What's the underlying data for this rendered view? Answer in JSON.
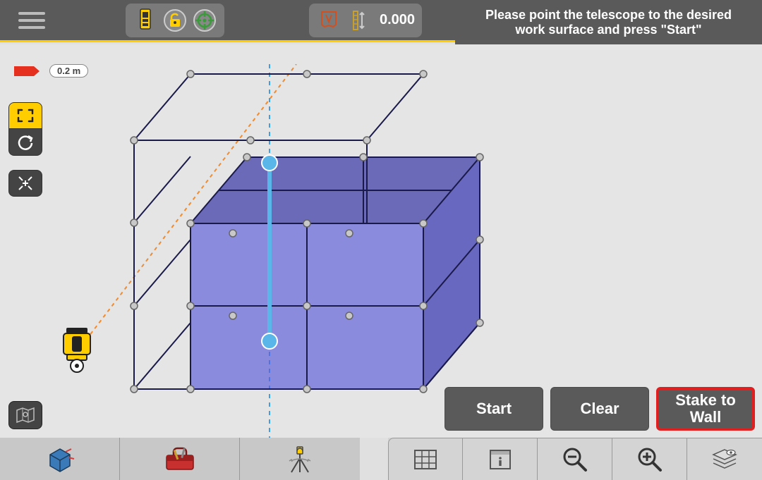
{
  "topbar": {
    "measurement_value": "0.000"
  },
  "instruction_text": "Please point the telescope to the desired work surface and press \"Start\"",
  "viewport": {
    "scale_label": "0.2 m"
  },
  "actions": {
    "start": "Start",
    "clear": "Clear",
    "stake_to_wall": "Stake to Wall"
  }
}
